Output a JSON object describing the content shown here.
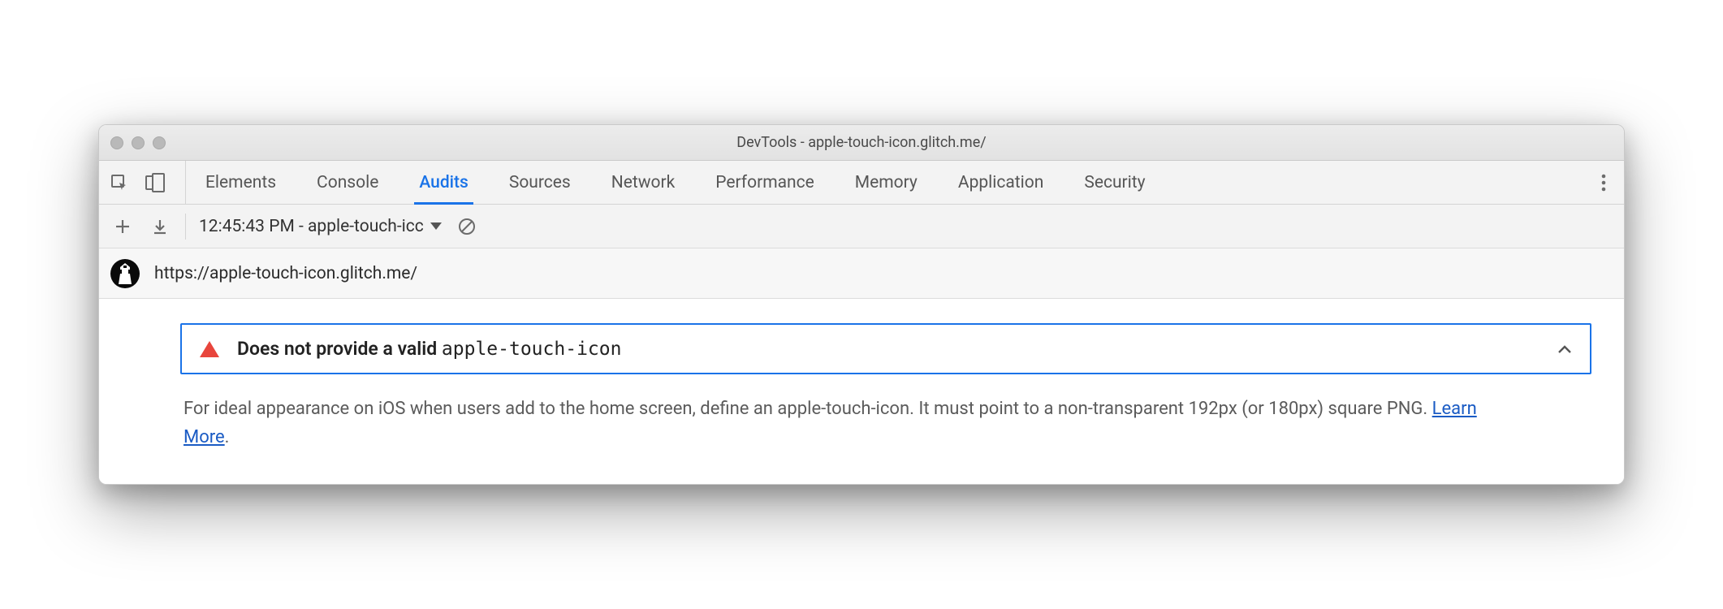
{
  "window": {
    "title": "DevTools - apple-touch-icon.glitch.me/"
  },
  "tabs": [
    {
      "label": "Elements",
      "active": false
    },
    {
      "label": "Console",
      "active": false
    },
    {
      "label": "Audits",
      "active": true
    },
    {
      "label": "Sources",
      "active": false
    },
    {
      "label": "Network",
      "active": false
    },
    {
      "label": "Performance",
      "active": false
    },
    {
      "label": "Memory",
      "active": false
    },
    {
      "label": "Application",
      "active": false
    },
    {
      "label": "Security",
      "active": false
    }
  ],
  "toolbar": {
    "report_label": "12:45:43 PM - apple-touch-icc"
  },
  "url_row": {
    "url": "https://apple-touch-icon.glitch.me/"
  },
  "audit": {
    "title_prefix": "Does not provide a valid ",
    "title_code": "apple-touch-icon",
    "description": "For ideal appearance on iOS when users add to the home screen, define an apple-touch-icon. It must point to a non-transparent 192px (or 180px) square PNG. ",
    "learn_more": "Learn More",
    "period": "."
  }
}
